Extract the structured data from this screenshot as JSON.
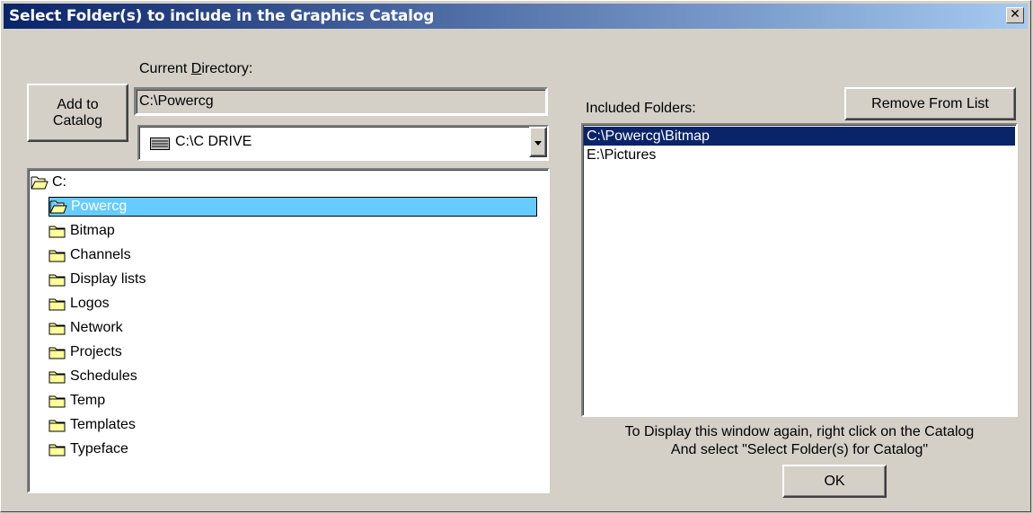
{
  "window": {
    "title": "Select Folder(s) to include in the Graphics Catalog",
    "close_glyph": "✕"
  },
  "left": {
    "add_button_line1": "Add to",
    "add_button_line2": "Catalog",
    "current_dir_label_pre": "Current ",
    "current_dir_label_accel": "D",
    "current_dir_label_post": "irectory:",
    "current_dir_value": "C:\\Powercg",
    "drive_value": "C:\\C DRIVE",
    "drive_icon": "drive-icon",
    "folders": [
      {
        "label": "C:",
        "indent": 0,
        "open": true,
        "selected": false
      },
      {
        "label": "Powercg",
        "indent": 1,
        "open": true,
        "selected": true
      },
      {
        "label": "Bitmap",
        "indent": 1,
        "open": false,
        "selected": false
      },
      {
        "label": "Channels",
        "indent": 1,
        "open": false,
        "selected": false
      },
      {
        "label": "Display lists",
        "indent": 1,
        "open": false,
        "selected": false
      },
      {
        "label": "Logos",
        "indent": 1,
        "open": false,
        "selected": false
      },
      {
        "label": "Network",
        "indent": 1,
        "open": false,
        "selected": false
      },
      {
        "label": "Projects",
        "indent": 1,
        "open": false,
        "selected": false
      },
      {
        "label": "Schedules",
        "indent": 1,
        "open": false,
        "selected": false
      },
      {
        "label": "Temp",
        "indent": 1,
        "open": false,
        "selected": false
      },
      {
        "label": "Templates",
        "indent": 1,
        "open": false,
        "selected": false
      },
      {
        "label": "Typeface",
        "indent": 1,
        "open": false,
        "selected": false
      }
    ]
  },
  "right": {
    "included_label": "Included Folders:",
    "remove_button": "Remove From List",
    "included": [
      {
        "label": "C:\\Powercg\\Bitmap",
        "selected": true
      },
      {
        "label": "E:\\Pictures",
        "selected": false
      }
    ],
    "hint_line1": "To Display this window again, right click on the Catalog",
    "hint_line2": "And select  \"Select Folder(s) for Catalog\"",
    "ok_button": "OK"
  },
  "colors": {
    "selection_tree": "#66ccff",
    "selection_list": "#0a246a",
    "folder_yellow": "#ffff99"
  }
}
